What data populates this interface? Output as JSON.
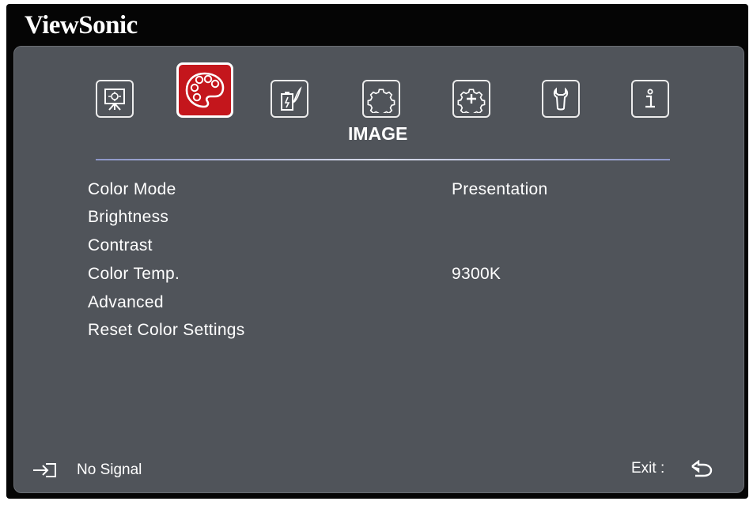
{
  "brand": "ViewSonic",
  "tabs": [
    {
      "name": "display",
      "icon": "display-icon",
      "active": false
    },
    {
      "name": "image",
      "icon": "palette-icon",
      "active": true
    },
    {
      "name": "power-management",
      "icon": "power-management-icon",
      "active": false
    },
    {
      "name": "basic",
      "icon": "basic-settings-icon",
      "active": false
    },
    {
      "name": "advanced",
      "icon": "advanced-settings-icon",
      "active": false
    },
    {
      "name": "system",
      "icon": "system-tool-icon",
      "active": false
    },
    {
      "name": "information",
      "icon": "information-icon",
      "active": false
    }
  ],
  "menu": {
    "title": "IMAGE",
    "items": [
      {
        "label": "Color Mode",
        "value": "Presentation"
      },
      {
        "label": "Brightness",
        "value": ""
      },
      {
        "label": "Contrast",
        "value": ""
      },
      {
        "label": "Color Temp.",
        "value": "9300K"
      },
      {
        "label": "Advanced",
        "value": ""
      },
      {
        "label": "Reset Color Settings",
        "value": ""
      }
    ]
  },
  "footer": {
    "source_icon": "input-source-icon",
    "source_status": "No Signal",
    "exit_label": "Exit :",
    "exit_icon": "return-arrow-icon"
  },
  "colors": {
    "panel": "#50545a",
    "active_tab": "#c4161c",
    "frame": "#050505"
  }
}
